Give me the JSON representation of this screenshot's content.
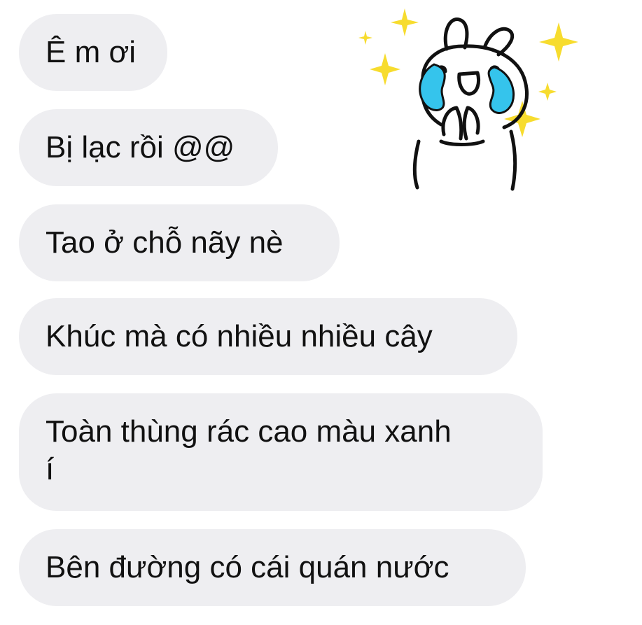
{
  "chat": {
    "messages": [
      {
        "text": "Ê m ơi"
      },
      {
        "text": "Bị lạc rồi @@"
      },
      {
        "text": "Tao ở chỗ nãy nè"
      },
      {
        "text": "Khúc mà có nhiều nhiều cây"
      },
      {
        "text_line1": "Toàn thùng rác cao màu xanh",
        "text_line2": "í"
      },
      {
        "text": "Bên đường có cái quán nước"
      }
    ],
    "sticker": {
      "icon": "crying-bunny-sticker-icon",
      "colors": {
        "tears": "#35c4ec",
        "sparkles": "#f7dc2e",
        "outline": "#111111"
      }
    }
  },
  "colors": {
    "bubble_bg": "#eeeef1",
    "text": "#111111"
  }
}
